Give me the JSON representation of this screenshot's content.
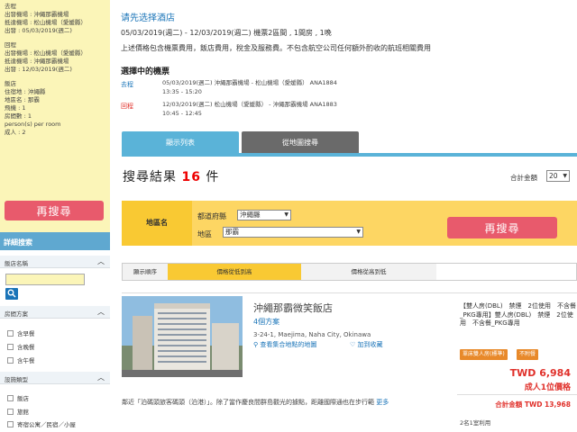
{
  "sidebar": {
    "summary_lines": [
      "去程",
      "出發機場 : 沖繩那霸機場",
      "抵達機場 : 松山機場（愛媛縣）",
      "出發 : 05/03/2019(週二)",
      "",
      "回程",
      "出發機場 : 松山機場（愛媛縣）",
      "抵達機場 : 沖繩那霸機場",
      "出發 : 12/03/2019(週二)",
      "",
      "飯店",
      "住宿地 : 沖繩縣",
      "地區名 : 那霸",
      "飛機 : 1",
      "房間數 : 1",
      "person(s) per room",
      "成人 : 2"
    ],
    "search_again": "再搜尋",
    "detail_search": "詳細搜索",
    "filters": {
      "hotel_name": "飯店名稱",
      "meal_plan": "房間方案",
      "meal_options": [
        "含早餐",
        "含晚餐",
        "含午餐"
      ],
      "lodging_type": "設施類型",
      "lodging_options": [
        "飯店",
        "旅館",
        "寄宿公寓／民宿／小屋"
      ]
    }
  },
  "main": {
    "select_hotel": "请先选择酒店",
    "trip_summary": "05/03/2019(週二) - 12/03/2019(週二)  機票2區間 , 1間房 , 1晚",
    "price_note": "上述價格包含機票費用，飯店費用，稅金及服務費。不包含航空公司任何額外酌收的航班相關費用",
    "selected_flights_title": "選擇中的機票",
    "flights": [
      {
        "direction": "去程",
        "line1": "05/03/2019(週二) 沖繩那霸機場 - 松山機場（愛媛縣）  ANA1884",
        "line2": "13:35 - 15:20"
      },
      {
        "direction": "回程",
        "line1": "12/03/2019(週二) 松山機場（愛媛縣） - 沖繩那霸機場  ANA1883",
        "line2": "10:45 - 12:45"
      }
    ],
    "tabs": {
      "list": "顯示列表",
      "map": "從地圖搜尋"
    },
    "results_label": "搜尋結果",
    "results_count": "16",
    "results_unit": "件",
    "total_label": "合計金額",
    "total_value": "20",
    "filter": {
      "label": "地區名",
      "prefecture_label": "都道府縣",
      "prefecture_value": "沖繩縣",
      "area_label": "地區",
      "area_value": "那霸",
      "search_again": "再搜尋"
    },
    "sort": {
      "label": "顯示順序",
      "low_to_high": "價格從低到高",
      "high_to_low": "價格從高到低"
    },
    "hotel": {
      "name": "沖繩那霸微笑飯店",
      "plan_count": "4個方案",
      "address": "3-24-1, Maejima, Naha City, Okinawa",
      "map_link": "查看集合地點的地圖",
      "fav_link": "加到收藏",
      "description": "鄰近「泊碼頭旅客碼頭（泊港）」。除了當作慶良間群島觀光的據點，距離國際通也在步行範",
      "more": "更多",
      "room_desc": "【雙人房(DBL)　禁煙　2位使用　不含餐_PKG專用】雙人房(DBL)　禁煙　2位使用　不含餐_PKG專用",
      "badge_room": "單床雙人房(標準)",
      "badge_nonrefund": "不附餐",
      "price": "TWD 6,984",
      "price_per": "成人1位價格",
      "total": "合計金額 TWD 13,968",
      "room_count": "2名1室利用"
    }
  }
}
